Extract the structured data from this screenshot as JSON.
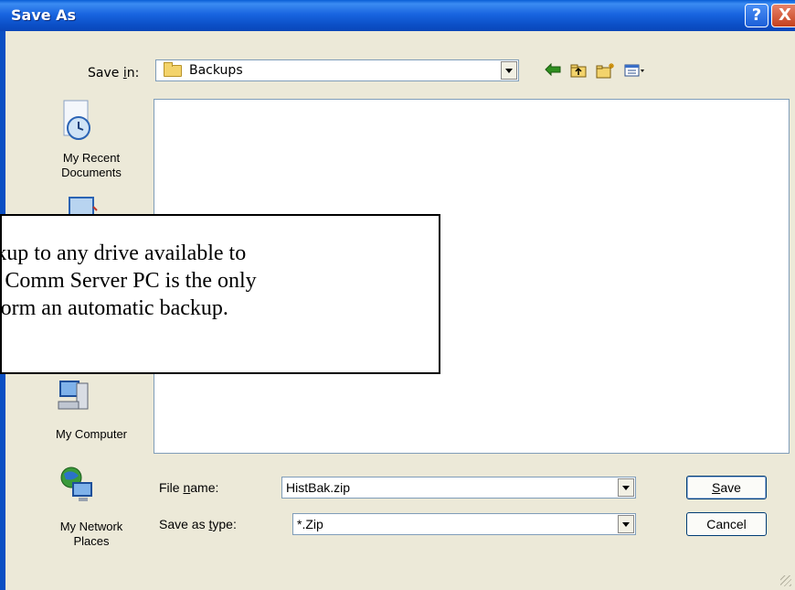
{
  "window": {
    "title": "Save As",
    "help_glyph": "?",
    "close_glyph": "X"
  },
  "save_in": {
    "label_pre": "Save ",
    "label_mnemonic": "i",
    "label_post": "n:",
    "value": "Backups"
  },
  "toolbar": {
    "back_icon": "back-arrow-icon",
    "up_icon": "up-folder-icon",
    "new_icon": "new-folder-icon",
    "views_icon": "views-menu-icon"
  },
  "places": [
    {
      "label_line1": "My Recent",
      "label_line2": "Documents",
      "icon": "recent-documents-icon"
    },
    {
      "label_line1": "My Computer",
      "label_line2": "",
      "icon": "my-computer-icon"
    },
    {
      "label_line1": "My Network",
      "label_line2": "Places",
      "icon": "network-places-icon"
    }
  ],
  "callout": {
    "line1": "backup to any drive available to",
    "line2": "The Comm Server PC is the only",
    "line3": "perform an automatic backup."
  },
  "file_name": {
    "label_pre": "File ",
    "label_mnemonic": "n",
    "label_post": "ame:",
    "value": "HistBak.zip"
  },
  "save_as_type": {
    "label_pre": "Save as ",
    "label_mnemonic": "t",
    "label_post": "ype:",
    "value": "*.Zip"
  },
  "buttons": {
    "save_mnemonic": "S",
    "save_rest": "ave",
    "cancel": "Cancel"
  },
  "colors": {
    "title_bar": "#0a5ed6",
    "dialog_bg": "#ece9d8",
    "field_border": "#7f9db9"
  }
}
